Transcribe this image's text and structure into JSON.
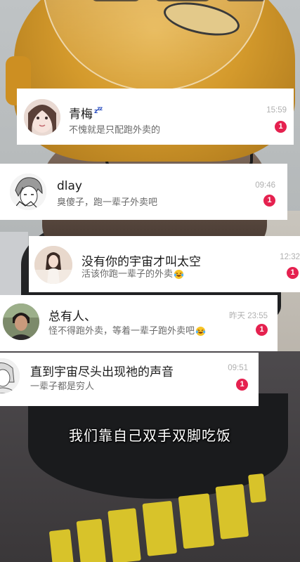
{
  "accent": {
    "badge": "#e5214f",
    "zzz": "#2b4fbf"
  },
  "notifications": [
    {
      "name": "青梅",
      "status_icon": "zzz-sleep-icon",
      "message": "不愧就是只配跑外卖的",
      "time": "15:59",
      "badge": "1",
      "message_emoji": ""
    },
    {
      "name": "dlay",
      "message": "臭傻子，跑一辈子外卖吧",
      "time": "09:46",
      "badge": "1",
      "message_emoji": ""
    },
    {
      "name": "没有你的宇宙才叫太空",
      "message": "活该你跑一辈子的外卖",
      "time": "12:32",
      "badge": "1",
      "message_emoji": "laughing-tears-emoji"
    },
    {
      "name": "总有人、",
      "message": "怪不得跑外卖，等着一辈子跑外卖吧",
      "time": "昨天 23:55",
      "badge": "1",
      "message_emoji": "laughing-tears-emoji"
    },
    {
      "name": "直到宇宙尽头出现祂的声音",
      "message": "一辈子都是穷人",
      "time": "09:51",
      "badge": "1",
      "message_emoji": ""
    }
  ],
  "subtitle": "我们靠自己双手双脚吃饭"
}
